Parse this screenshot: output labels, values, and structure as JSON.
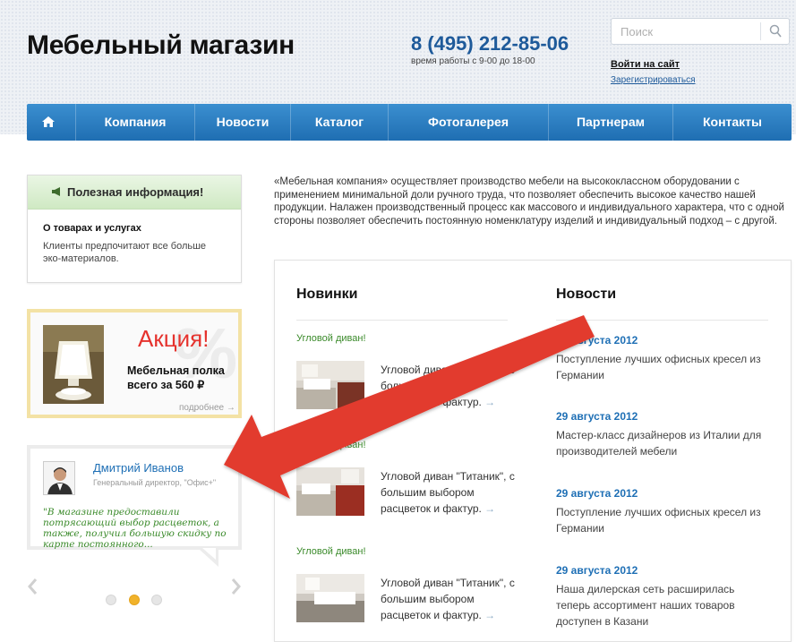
{
  "header": {
    "site_title": "Мебельный магазин",
    "phone": "8 (495) 212-85-06",
    "hours": "время работы с 9-00 до 18-00",
    "search_placeholder": "Поиск",
    "login": "Войти на сайт",
    "register": "Зарегистрироваться"
  },
  "nav": {
    "home_icon": "home-icon",
    "items": [
      "Компания",
      "Новости",
      "Каталог",
      "Фотогалерея",
      "Партнерам",
      "Контакты"
    ]
  },
  "sidebar": {
    "info": {
      "title": "Полезная информация!",
      "subtitle": "О товарах и услугах",
      "text": "Клиенты предпочитают все больше эко-материалов."
    },
    "promo": {
      "title": "Акция!",
      "text": "Мебельная полка всего за 560 ₽",
      "more": "подробнее →"
    },
    "testimonial": {
      "name": "Дмитрий Иванов",
      "role": "Генеральный директор, \"Офис+\"",
      "quote": "\"В магазине предоставили потрясающий выбор расцветок, а также, получил большую скидку по карте постоянного..."
    },
    "slider": {
      "count": 3,
      "active": 2
    }
  },
  "intro": "«Мебельная компания» осуществляет производство мебели на высококлассном оборудовании с применением минимальной доли ручного труда, что позволяет обеспечить высокое качество нашей продукции. Налажен производственный процесс как массового и индивидуального характера, что с одной стороны позволяет обеспечить постоянную номенклатуру изделий и индивидуальный подход – с другой.",
  "new_items": {
    "title": "Новинки",
    "items": [
      {
        "category": "Угловой диван!",
        "text": "Угловой диван \"Титаник\", с большим выбором расцветок и фактур."
      },
      {
        "category": "Угловой диван!",
        "text": "Угловой диван \"Титаник\", с большим выбором расцветок и фактур."
      },
      {
        "category": "Угловой диван!",
        "text": "Угловой диван \"Титаник\", с большим выбором расцветок и фактур."
      }
    ]
  },
  "news": {
    "title": "Новости",
    "items": [
      {
        "date": "29 августа 2012",
        "text": "Поступление лучших офисных кресел из Германии"
      },
      {
        "date": "29 августа 2012",
        "text": "Мастер-класс дизайнеров из Италии для производителей мебели"
      },
      {
        "date": "29 августа 2012",
        "text": "Поступление лучших офисных кресел из Германии"
      },
      {
        "date": "29 августа 2012",
        "text": "Наша дилерская сеть расширилась теперь ассортимент наших товаров доступен в Казани"
      }
    ]
  },
  "colors": {
    "accent": "#1e6fb5",
    "nav": "#2a7cc0",
    "promo": "#e5322d",
    "green": "#3a8a2a",
    "annotation_arrow": "#e23a2e"
  }
}
